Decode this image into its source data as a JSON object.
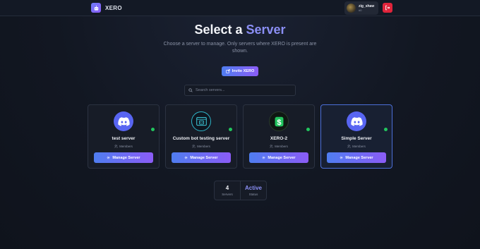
{
  "header": {
    "brand": "XERO",
    "user": {
      "name": "zig_shaw",
      "id": "#0"
    }
  },
  "main": {
    "title_prefix": "Select a",
    "title_accent": "Server",
    "subtitle": "Choose a server to manage. Only servers where XERO is present are shown.",
    "invite_label": "Invite XERO",
    "search_placeholder": "Search servers..."
  },
  "servers": [
    {
      "name": "test server",
      "members_label": "Members",
      "manage_label": "Manage Server",
      "icon": "discord-icon",
      "status": "online"
    },
    {
      "name": "Custom bot testing server",
      "members_label": "Members",
      "manage_label": "Manage Server",
      "icon": "bot-server-icon",
      "status": "online"
    },
    {
      "name": "XERO-2",
      "members_label": "Members",
      "manage_label": "Manage Server",
      "icon": "dollar-icon",
      "status": "online"
    },
    {
      "name": "Simple Server",
      "members_label": "Members",
      "manage_label": "Manage Server",
      "icon": "discord-icon",
      "status": "online",
      "selected": true
    }
  ],
  "stats": [
    {
      "value": "4",
      "label": "Servers"
    },
    {
      "value": "Active",
      "label": "Status"
    }
  ],
  "colors": {
    "accent": "#8b8ff5",
    "button_start": "#4f7df0",
    "button_end": "#8b5cf6",
    "online": "#22c55e",
    "logout": "#e0243b",
    "discord": "#5865f2"
  }
}
